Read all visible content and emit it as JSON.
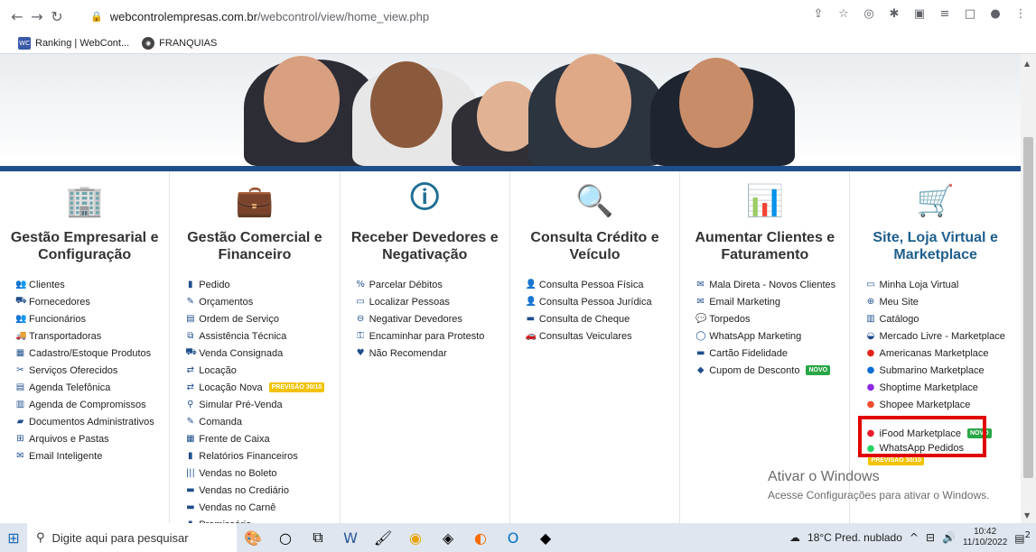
{
  "browser": {
    "url_host": "webcontrolempresas.com.br",
    "url_path": "/webcontrol/view/home_view.php",
    "bookmarks": [
      {
        "label": "Ranking | WebCont...",
        "icon": "webcontrol-favicon-icon"
      },
      {
        "label": "FRANQUIAS",
        "icon": "franquias-favicon-icon"
      }
    ]
  },
  "columns": [
    {
      "title": "Gestão Empresarial e Configuração",
      "icon": "building-user-icon",
      "items": [
        {
          "label": "Clientes"
        },
        {
          "label": "Fornecedores"
        },
        {
          "label": "Funcionários"
        },
        {
          "label": "Transportadoras"
        },
        {
          "label": "Cadastro/Estoque Produtos"
        },
        {
          "label": "Serviços Oferecidos"
        },
        {
          "label": "Agenda Telefônica"
        },
        {
          "label": "Agenda de Compromissos"
        },
        {
          "label": "Documentos Administrativos"
        },
        {
          "label": "Arquivos e Pastas"
        },
        {
          "label": "Email Inteligente"
        }
      ]
    },
    {
      "title": "Gestão Comercial e Financeiro",
      "icon": "briefcase-icon",
      "items": [
        {
          "label": "Pedido"
        },
        {
          "label": "Orçamentos"
        },
        {
          "label": "Ordem de Serviço"
        },
        {
          "label": "Assistência Técnica"
        },
        {
          "label": "Venda Consignada"
        },
        {
          "label": "Locação"
        },
        {
          "label": "Locação Nova",
          "badge": "PREVISÃO 30/10"
        },
        {
          "label": "Simular Pré-Venda"
        },
        {
          "label": "Comanda"
        },
        {
          "label": "Frente de Caixa"
        },
        {
          "label": "Relatórios Financeiros"
        },
        {
          "label": "Vendas no Boleto"
        },
        {
          "label": "Vendas no Crediário"
        },
        {
          "label": "Vendas no Carnê"
        },
        {
          "label": "Promissória"
        }
      ]
    },
    {
      "title": "Receber Devedores e Negativação",
      "icon": "person-alert-icon",
      "items": [
        {
          "label": "Parcelar Débitos"
        },
        {
          "label": "Localizar Pessoas"
        },
        {
          "label": "Negativar Devedores"
        },
        {
          "label": "Encaminhar para Protesto"
        },
        {
          "label": "Não Recomendar"
        }
      ]
    },
    {
      "title": "Consulta Crédito e Veículo",
      "icon": "search-dollar-icon",
      "items": [
        {
          "label": "Consulta Pessoa Física"
        },
        {
          "label": "Consulta Pessoa Jurídica"
        },
        {
          "label": "Consulta de Cheque"
        },
        {
          "label": "Consultas Veiculares"
        }
      ]
    },
    {
      "title": "Aumentar Clientes e Faturamento",
      "icon": "chart-bar-icon",
      "items": [
        {
          "label": "Mala Direta - Novos Clientes"
        },
        {
          "label": "Email Marketing"
        },
        {
          "label": "Torpedos"
        },
        {
          "label": "WhatsApp Marketing"
        },
        {
          "label": "Cartão Fidelidade"
        },
        {
          "label": "Cupom de Desconto",
          "badge": "NOVO"
        }
      ]
    },
    {
      "title": "Site, Loja Virtual e Marketplace",
      "icon": "cart-arrow-down-icon",
      "items": [
        {
          "label": "Minha Loja Virtual"
        },
        {
          "label": "Meu Site"
        },
        {
          "label": "Catálogo"
        },
        {
          "label": "Mercado Livre - Marketplace"
        },
        {
          "label": "Americanas Marketplace"
        },
        {
          "label": "Submarino Marketplace"
        },
        {
          "label": "Shoptime Marketplace"
        },
        {
          "label": "Shopee Marketplace"
        },
        {
          "label": "iFood Marketplace",
          "badge": "NOVO"
        },
        {
          "label": "WhatsApp Pedidos",
          "badge": "PREVISÃO 30/10"
        }
      ]
    }
  ],
  "watermark": {
    "line1": "Ativar o Windows",
    "line2": "Acesse Configurações para ativar o Windows."
  },
  "taskbar": {
    "search_placeholder": "Digite aqui para pesquisar",
    "weather": "18°C  Pred. nublado",
    "time": "10:42",
    "date": "11/10/2022",
    "notifications": "2"
  }
}
